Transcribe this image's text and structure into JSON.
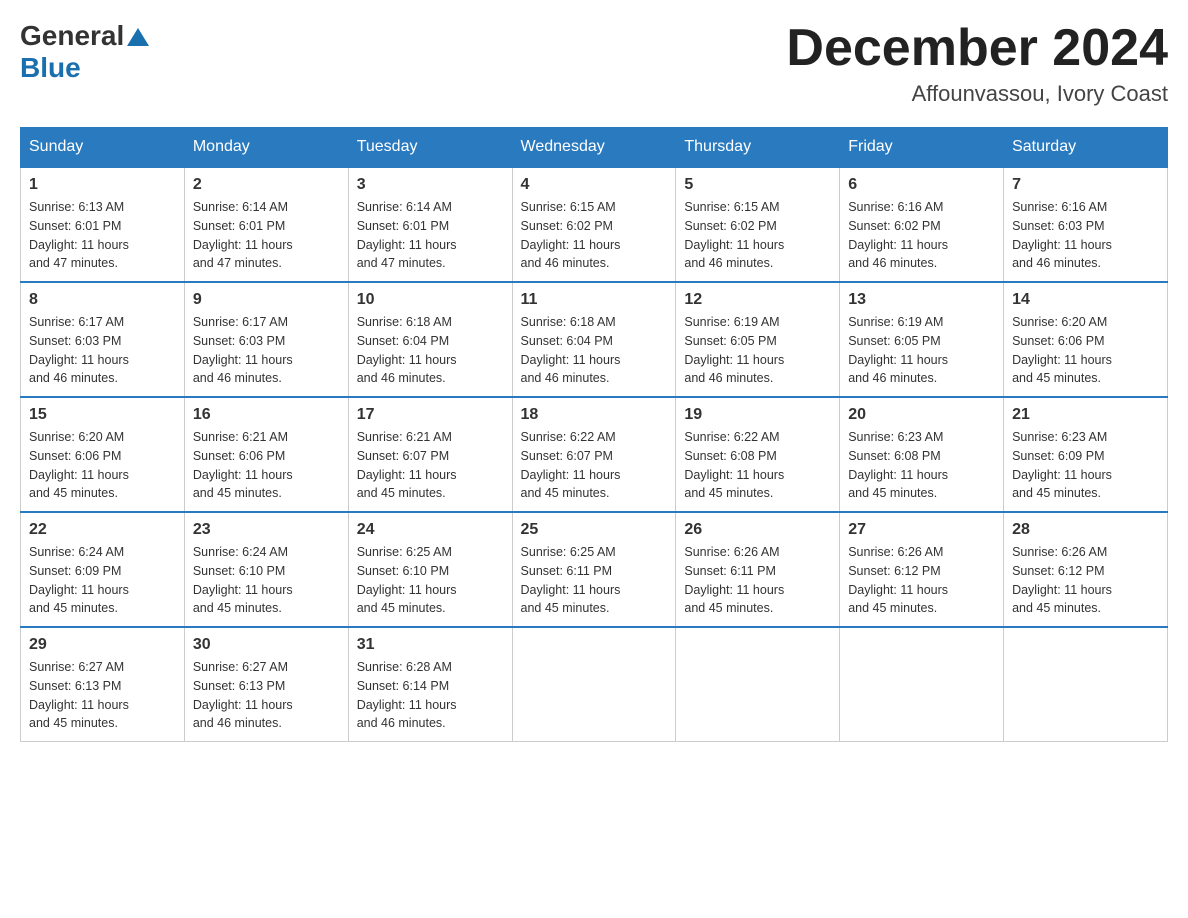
{
  "logo": {
    "general": "General",
    "blue": "Blue"
  },
  "header": {
    "month": "December 2024",
    "location": "Affounvassou, Ivory Coast"
  },
  "weekdays": [
    "Sunday",
    "Monday",
    "Tuesday",
    "Wednesday",
    "Thursday",
    "Friday",
    "Saturday"
  ],
  "weeks": [
    [
      {
        "day": "1",
        "sunrise": "6:13 AM",
        "sunset": "6:01 PM",
        "daylight": "11 hours and 47 minutes."
      },
      {
        "day": "2",
        "sunrise": "6:14 AM",
        "sunset": "6:01 PM",
        "daylight": "11 hours and 47 minutes."
      },
      {
        "day": "3",
        "sunrise": "6:14 AM",
        "sunset": "6:01 PM",
        "daylight": "11 hours and 47 minutes."
      },
      {
        "day": "4",
        "sunrise": "6:15 AM",
        "sunset": "6:02 PM",
        "daylight": "11 hours and 46 minutes."
      },
      {
        "day": "5",
        "sunrise": "6:15 AM",
        "sunset": "6:02 PM",
        "daylight": "11 hours and 46 minutes."
      },
      {
        "day": "6",
        "sunrise": "6:16 AM",
        "sunset": "6:02 PM",
        "daylight": "11 hours and 46 minutes."
      },
      {
        "day": "7",
        "sunrise": "6:16 AM",
        "sunset": "6:03 PM",
        "daylight": "11 hours and 46 minutes."
      }
    ],
    [
      {
        "day": "8",
        "sunrise": "6:17 AM",
        "sunset": "6:03 PM",
        "daylight": "11 hours and 46 minutes."
      },
      {
        "day": "9",
        "sunrise": "6:17 AM",
        "sunset": "6:03 PM",
        "daylight": "11 hours and 46 minutes."
      },
      {
        "day": "10",
        "sunrise": "6:18 AM",
        "sunset": "6:04 PM",
        "daylight": "11 hours and 46 minutes."
      },
      {
        "day": "11",
        "sunrise": "6:18 AM",
        "sunset": "6:04 PM",
        "daylight": "11 hours and 46 minutes."
      },
      {
        "day": "12",
        "sunrise": "6:19 AM",
        "sunset": "6:05 PM",
        "daylight": "11 hours and 46 minutes."
      },
      {
        "day": "13",
        "sunrise": "6:19 AM",
        "sunset": "6:05 PM",
        "daylight": "11 hours and 46 minutes."
      },
      {
        "day": "14",
        "sunrise": "6:20 AM",
        "sunset": "6:06 PM",
        "daylight": "11 hours and 45 minutes."
      }
    ],
    [
      {
        "day": "15",
        "sunrise": "6:20 AM",
        "sunset": "6:06 PM",
        "daylight": "11 hours and 45 minutes."
      },
      {
        "day": "16",
        "sunrise": "6:21 AM",
        "sunset": "6:06 PM",
        "daylight": "11 hours and 45 minutes."
      },
      {
        "day": "17",
        "sunrise": "6:21 AM",
        "sunset": "6:07 PM",
        "daylight": "11 hours and 45 minutes."
      },
      {
        "day": "18",
        "sunrise": "6:22 AM",
        "sunset": "6:07 PM",
        "daylight": "11 hours and 45 minutes."
      },
      {
        "day": "19",
        "sunrise": "6:22 AM",
        "sunset": "6:08 PM",
        "daylight": "11 hours and 45 minutes."
      },
      {
        "day": "20",
        "sunrise": "6:23 AM",
        "sunset": "6:08 PM",
        "daylight": "11 hours and 45 minutes."
      },
      {
        "day": "21",
        "sunrise": "6:23 AM",
        "sunset": "6:09 PM",
        "daylight": "11 hours and 45 minutes."
      }
    ],
    [
      {
        "day": "22",
        "sunrise": "6:24 AM",
        "sunset": "6:09 PM",
        "daylight": "11 hours and 45 minutes."
      },
      {
        "day": "23",
        "sunrise": "6:24 AM",
        "sunset": "6:10 PM",
        "daylight": "11 hours and 45 minutes."
      },
      {
        "day": "24",
        "sunrise": "6:25 AM",
        "sunset": "6:10 PM",
        "daylight": "11 hours and 45 minutes."
      },
      {
        "day": "25",
        "sunrise": "6:25 AM",
        "sunset": "6:11 PM",
        "daylight": "11 hours and 45 minutes."
      },
      {
        "day": "26",
        "sunrise": "6:26 AM",
        "sunset": "6:11 PM",
        "daylight": "11 hours and 45 minutes."
      },
      {
        "day": "27",
        "sunrise": "6:26 AM",
        "sunset": "6:12 PM",
        "daylight": "11 hours and 45 minutes."
      },
      {
        "day": "28",
        "sunrise": "6:26 AM",
        "sunset": "6:12 PM",
        "daylight": "11 hours and 45 minutes."
      }
    ],
    [
      {
        "day": "29",
        "sunrise": "6:27 AM",
        "sunset": "6:13 PM",
        "daylight": "11 hours and 45 minutes."
      },
      {
        "day": "30",
        "sunrise": "6:27 AM",
        "sunset": "6:13 PM",
        "daylight": "11 hours and 46 minutes."
      },
      {
        "day": "31",
        "sunrise": "6:28 AM",
        "sunset": "6:14 PM",
        "daylight": "11 hours and 46 minutes."
      },
      null,
      null,
      null,
      null
    ]
  ],
  "labels": {
    "sunrise": "Sunrise:",
    "sunset": "Sunset:",
    "daylight": "Daylight:"
  }
}
